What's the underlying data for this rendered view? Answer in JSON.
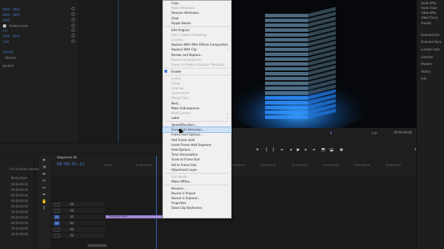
{
  "effect_controls": {
    "rows": [
      {
        "a": "0002",
        "b": "0002"
      },
      {
        "a": "0002",
        "b": "0002"
      },
      {
        "a": "0002",
        "b": ""
      },
      {
        "a": "Uniform Scale",
        "b": ""
      },
      {
        "a": "0.0",
        "b": ""
      },
      {
        "a": "0002",
        "b": "0002"
      },
      {
        "a": "0.00",
        "b": ""
      }
    ],
    "blend_label": "Normal",
    "opacity_label": "Opacity",
    "opacity_value": "100.0%",
    "opacity_mode": "Normal",
    "bottom_value": "00:00:0"
  },
  "context_menu": {
    "items": [
      {
        "label": "Copy",
        "enabled": true
      },
      {
        "label": "Paste Attributes...",
        "enabled": false
      },
      {
        "label": "Remove Attributes...",
        "enabled": true
      },
      {
        "label": "Clear",
        "enabled": true
      },
      {
        "label": "Ripple Delete",
        "enabled": true
      },
      {
        "label": "Edit Original",
        "enabled": true
      },
      {
        "label": "Edit in Adobe Photoshop",
        "enabled": false
      },
      {
        "label": "License...",
        "enabled": false
      },
      {
        "label": "Replace With After Effects Composition",
        "enabled": true
      },
      {
        "label": "Replace With Clip",
        "enabled": true,
        "submenu": true
      },
      {
        "label": "Render and Replace...",
        "enabled": true
      },
      {
        "label": "Restore Unrendered",
        "enabled": false
      },
      {
        "label": "Export As Motion Graphics Template...",
        "enabled": false
      },
      {
        "label": "Enable",
        "enabled": true,
        "checked": true
      },
      {
        "label": "Unlink",
        "enabled": false
      },
      {
        "label": "Group",
        "enabled": false
      },
      {
        "label": "Ungroup",
        "enabled": false
      },
      {
        "label": "Synchronize",
        "enabled": false
      },
      {
        "label": "Merge Clips...",
        "enabled": false
      },
      {
        "label": "Nest...",
        "enabled": true
      },
      {
        "label": "Make Subsequence",
        "enabled": true
      },
      {
        "label": "Multi-Camera",
        "enabled": false,
        "submenu": true
      },
      {
        "label": "Label",
        "enabled": true,
        "submenu": true
      },
      {
        "label": "Speed/Duration...",
        "enabled": true
      },
      {
        "label": "Scene Edit Detection...",
        "enabled": true,
        "highlighted": true
      },
      {
        "label": "Frame Hold Options...",
        "enabled": true
      },
      {
        "label": "Add Frame Hold",
        "enabled": true
      },
      {
        "label": "Insert Frame Hold Segment",
        "enabled": true
      },
      {
        "label": "Field Options...",
        "enabled": true
      },
      {
        "label": "Time Interpolation",
        "enabled": true,
        "submenu": true
      },
      {
        "label": "Scale to Frame Size",
        "enabled": true
      },
      {
        "label": "Set to Frame Size",
        "enabled": true
      },
      {
        "label": "Adjustment Layer",
        "enabled": true
      },
      {
        "label": "Link Media...",
        "enabled": false
      },
      {
        "label": "Make Offline...",
        "enabled": true
      },
      {
        "label": "Rename...",
        "enabled": true
      },
      {
        "label": "Reveal in Project",
        "enabled": true
      },
      {
        "label": "Reveal in Explorer...",
        "enabled": true
      },
      {
        "label": "Properties",
        "enabled": true
      },
      {
        "label": "Show Clip Keyframes",
        "enabled": true,
        "submenu": true
      }
    ]
  },
  "program_monitor": {
    "zoom": "Full",
    "timecode": "00:00:04:08"
  },
  "right_panel": {
    "items": [
      "Audio Effec",
      "Audio Track",
      "Video Effec",
      "Video Transi",
      "Presets",
      "Essential Gra",
      "Essential Soun",
      "Lumetri Color",
      "Libraries",
      "Markers",
      "History",
      "Info"
    ]
  },
  "project": {
    "selection_info": "1 of 10 items selected",
    "column_header": "Media Start",
    "rows": [
      "00:00:00:00",
      "00:00:00:00",
      "00:00:00:00",
      "00:00:00:00",
      "00:00:00:00",
      "00:00:00:00",
      "00:00:00:00",
      "00:00:00:00",
      "00:00:00:00",
      "00:00:00:00"
    ]
  },
  "timeline": {
    "sequence_tab": "Sequence 01",
    "timecode": "00:00:01:22",
    "ticks": [
      "00:00",
      "00:00:01:00",
      "00:00:02:00",
      "00:00:03:00",
      "00:00:04:00",
      "00:00:05:00",
      "00:00:06:00",
      "00:00:07:00",
      "00:00:08:00",
      "00:00:09:00"
    ],
    "tracks": [
      {
        "name": "V3",
        "badge": "",
        "active": false
      },
      {
        "name": "V2",
        "badge": "",
        "active": false
      },
      {
        "name": "V1",
        "badge": "V1",
        "active": true
      },
      {
        "name": "A1",
        "badge": "A1",
        "active": true
      },
      {
        "name": "A2",
        "badge": "",
        "active": false
      },
      {
        "name": "A3",
        "badge": "",
        "active": false
      }
    ],
    "clip_label": "Elemental.mov",
    "master_label": "0.0"
  }
}
